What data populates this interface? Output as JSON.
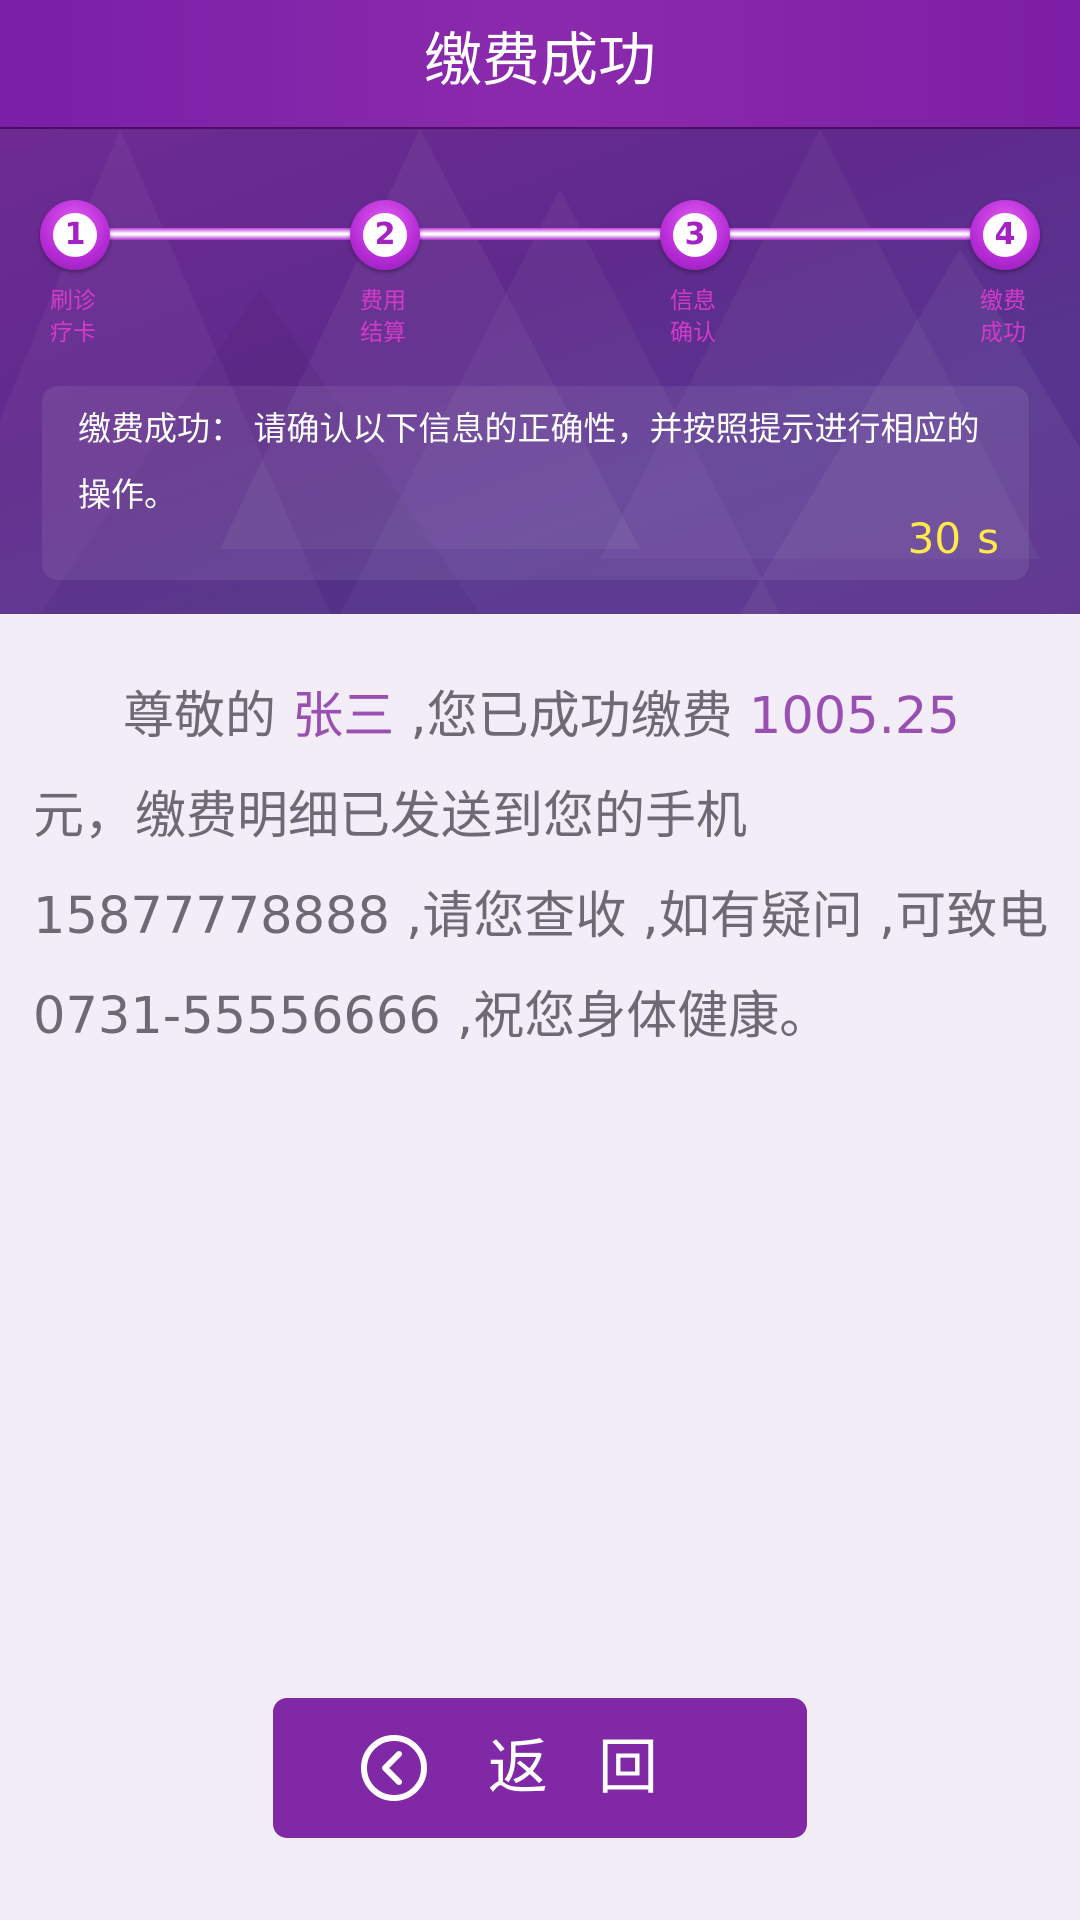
{
  "header": {
    "title": "缴费成功"
  },
  "progress": {
    "steps": [
      {
        "number": "1",
        "label_line1": "刷诊",
        "label_line2": "疗卡"
      },
      {
        "number": "2",
        "label_line1": "费用",
        "label_line2": "结算"
      },
      {
        "number": "3",
        "label_line1": "信息",
        "label_line2": "确认"
      },
      {
        "number": "4",
        "label_line1": "缴费",
        "label_line2": "成功"
      }
    ],
    "current_step": 4
  },
  "notice": {
    "text": "缴费成功： 请确认以下信息的正确性，并按照提示进行相应的操作。",
    "countdown_value": "30",
    "countdown_unit": "s"
  },
  "message": {
    "part1": "尊敬的 ",
    "name": "张三",
    "part2": " ,您已成功缴费 ",
    "amount": "1005.25",
    "part3": " 元，缴费明细已发送到您的手机 15877778888 ,请您查收 ,如有疑问 ,可致电 0731-55556666 ,祝您身体健康。"
  },
  "back_button": {
    "label": "返回"
  },
  "colors": {
    "header": "#8b2aac",
    "accent": "#9a4fb3",
    "countdown": "#ffe94a",
    "button": "#8028a6"
  },
  "icons": {
    "back": "chevron-left-circle-icon"
  }
}
